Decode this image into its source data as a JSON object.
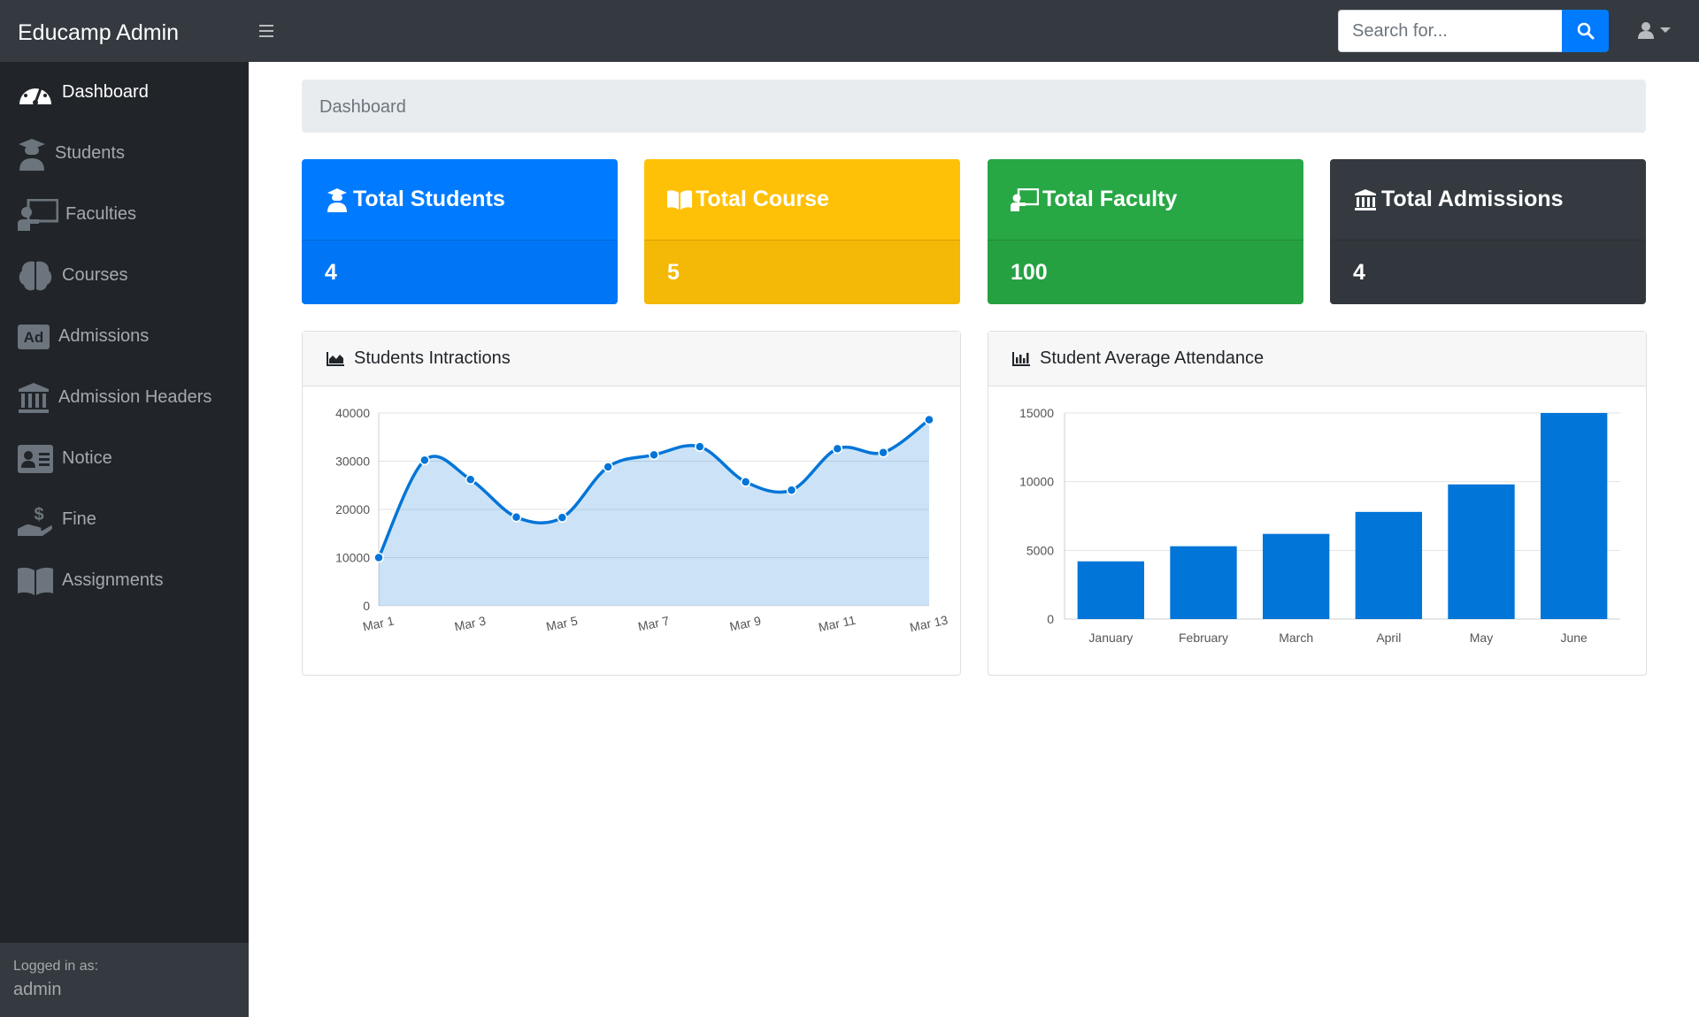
{
  "app": {
    "brand": "Educamp Admin"
  },
  "topbar": {
    "menu_icon": "hamburger-icon",
    "search": {
      "placeholder": "Search for...",
      "value": "",
      "button_icon": "search-icon"
    },
    "user_icon": "user-icon"
  },
  "sidebar": {
    "items": [
      {
        "label": "Dashboard",
        "icon": "tachometer-icon",
        "active": true
      },
      {
        "label": "Students",
        "icon": "graduate-icon",
        "active": false
      },
      {
        "label": "Faculties",
        "icon": "chalkboard-teacher-icon",
        "active": false
      },
      {
        "label": "Courses",
        "icon": "brain-icon",
        "active": false
      },
      {
        "label": "Admissions",
        "icon": "ad-icon",
        "active": false
      },
      {
        "label": "Admission Headers",
        "icon": "university-icon",
        "active": false
      },
      {
        "label": "Notice",
        "icon": "id-card-icon",
        "active": false
      },
      {
        "label": "Fine",
        "icon": "hand-dollar-icon",
        "active": false
      },
      {
        "label": "Assignments",
        "icon": "book-icon",
        "active": false
      }
    ],
    "footer": {
      "caption": "Logged in as:",
      "username": "admin"
    }
  },
  "breadcrumb": {
    "current": "Dashboard"
  },
  "stats": [
    {
      "title": "Total Students",
      "value": "4",
      "icon": "graduate-icon",
      "color": "#007bff"
    },
    {
      "title": "Total Course",
      "value": "5",
      "icon": "book-open-icon",
      "color": "#ffc107"
    },
    {
      "title": "Total Faculty",
      "value": "100",
      "icon": "chalkboard-teacher-icon",
      "color": "#28a745"
    },
    {
      "title": "Total Admissions",
      "value": "4",
      "icon": "university-icon",
      "color": "#343a40"
    }
  ],
  "cards": {
    "interactions": {
      "title": "Students Intractions",
      "icon": "area-chart-icon"
    },
    "attendance": {
      "title": "Student Average Attendance",
      "icon": "bar-chart-icon"
    }
  },
  "chart_data": [
    {
      "type": "area",
      "title": "Students Intractions",
      "x": [
        "Mar 1",
        "Mar 2",
        "Mar 3",
        "Mar 4",
        "Mar 5",
        "Mar 6",
        "Mar 7",
        "Mar 8",
        "Mar 9",
        "Mar 10",
        "Mar 11",
        "Mar 12",
        "Mar 13"
      ],
      "tick_labels": [
        "Mar 1",
        "Mar 3",
        "Mar 5",
        "Mar 7",
        "Mar 9",
        "Mar 11",
        "Mar 13"
      ],
      "values": [
        10000,
        30200,
        26200,
        18400,
        18300,
        28800,
        31300,
        33000,
        25700,
        24000,
        32600,
        31800,
        38600
      ],
      "ylim": [
        0,
        40000
      ],
      "yticks": [
        0,
        10000,
        20000,
        30000,
        40000
      ],
      "color": "#007bff",
      "grid": true
    },
    {
      "type": "bar",
      "title": "Student Average Attendance",
      "categories": [
        "January",
        "February",
        "March",
        "April",
        "May",
        "June"
      ],
      "values": [
        4200,
        5300,
        6200,
        7800,
        9800,
        15000
      ],
      "ylim": [
        0,
        15000
      ],
      "yticks": [
        0,
        5000,
        10000,
        15000
      ],
      "color": "#0275d8",
      "grid": true
    }
  ]
}
